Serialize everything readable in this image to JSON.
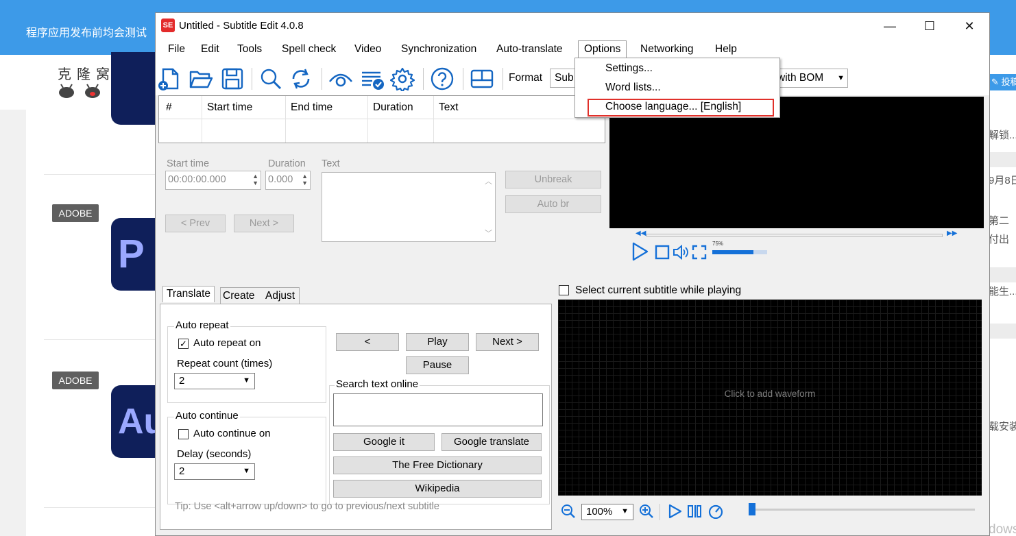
{
  "background_page": {
    "topbar_text": "程序应用发布前均会测试",
    "logo_text": "克隆窝",
    "tags": [
      "ADOBE",
      "ADOBE"
    ],
    "app_icons": [
      "P",
      "Au"
    ],
    "right_snippets": [
      "解锁...",
      "9月8日",
      "第二",
      "付出",
      "能生...",
      "载安装"
    ],
    "right_button": "投稿",
    "watermark": "激活 Windows"
  },
  "window": {
    "title": "Untitled - Subtitle Edit 4.0.8",
    "app_icon_text": "SE",
    "controls": {
      "minimize": "—",
      "maximize": "☐",
      "close": "✕"
    }
  },
  "menu": {
    "items": [
      "File",
      "Edit",
      "Tools",
      "Spell check",
      "Video",
      "Synchronization",
      "Auto-translate",
      "Options",
      "Networking",
      "Help"
    ],
    "active": "Options"
  },
  "options_dropdown": {
    "items": [
      "Settings...",
      "Word lists...",
      "Choose language... [English]"
    ],
    "highlighted_index": 2,
    "highlight_color": "#e0302a"
  },
  "toolbar": {
    "icons": [
      "new-file-icon",
      "open-folder-icon",
      "save-icon",
      "find-icon",
      "replace-icon",
      "visual-sync-icon",
      "spell-check-icon",
      "settings-icon",
      "help-icon",
      "layout-icon"
    ],
    "format_label": "Format",
    "format_value": "Sub",
    "encoding_value": "with BOM"
  },
  "grid": {
    "columns": [
      "#",
      "Start time",
      "End time",
      "Duration",
      "Text"
    ]
  },
  "edit_panel": {
    "start_time_label": "Start time",
    "start_time_value": "00:00:00.000",
    "duration_label": "Duration",
    "duration_value": "0.000",
    "text_label": "Text",
    "prev_label": "< Prev",
    "next_label": "Next >",
    "unbreak_label": "Unbreak",
    "auto_br_label": "Auto br"
  },
  "video_player": {
    "volume_percent": "75%",
    "volume_level": 0.75
  },
  "tabs": {
    "items": [
      "Translate",
      "Create",
      "Adjust"
    ],
    "selected": "Translate"
  },
  "translate_tab": {
    "auto_repeat_group": "Auto repeat",
    "auto_repeat_on_label": "Auto repeat on",
    "auto_repeat_on_checked": true,
    "repeat_count_label": "Repeat count (times)",
    "repeat_count_value": "2",
    "auto_continue_group": "Auto continue",
    "auto_continue_on_label": "Auto continue on",
    "auto_continue_on_checked": false,
    "delay_label": "Delay (seconds)",
    "delay_value": "2",
    "prev_btn": "<",
    "play_btn": "Play",
    "next_btn": "Next >",
    "pause_btn": "Pause",
    "search_group": "Search text online",
    "google_it": "Google it",
    "google_translate": "Google translate",
    "free_dictionary": "The Free Dictionary",
    "wikipedia": "Wikipedia",
    "tip": "Tip: Use <alt+arrow up/down> to go to previous/next subtitle"
  },
  "waveform": {
    "select_current_label": "Select current subtitle while playing",
    "select_current_checked": false,
    "placeholder": "Click to add waveform",
    "zoom_value": "100%"
  }
}
